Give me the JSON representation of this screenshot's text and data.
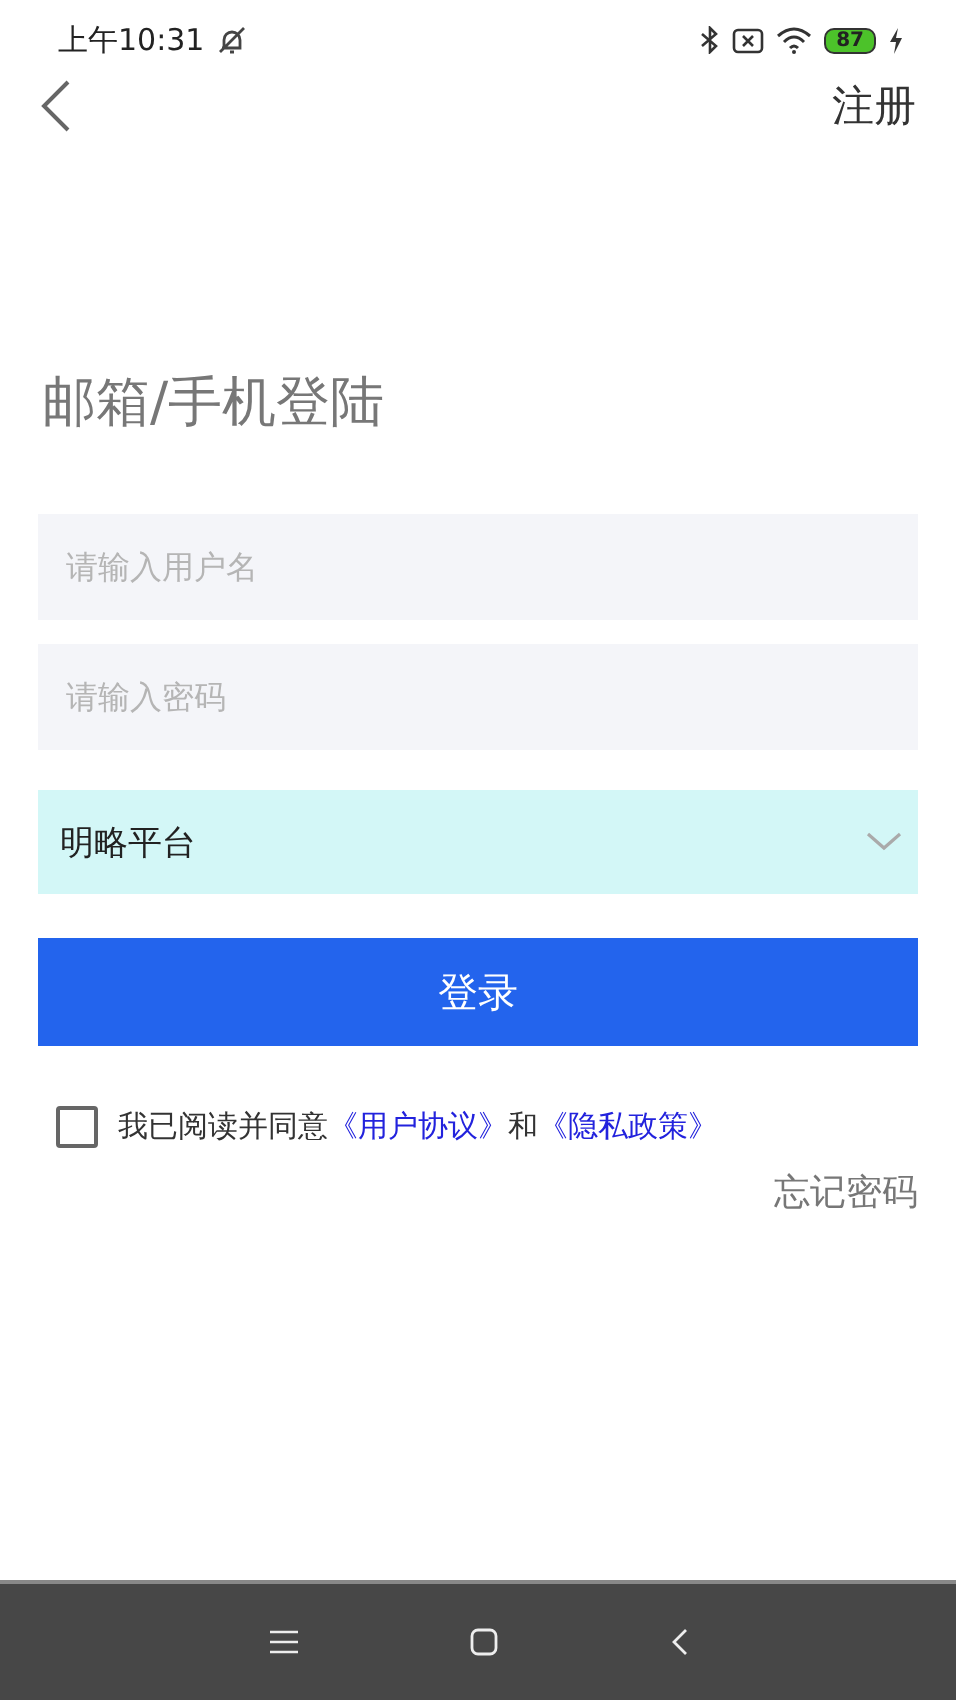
{
  "status_bar": {
    "time": "上午10:31",
    "battery": "87"
  },
  "header": {
    "action": "注册"
  },
  "title": "邮箱/手机登陆",
  "fields": [
    {
      "placeholder": "请输入用户名"
    },
    {
      "placeholder": "请输入密码"
    }
  ],
  "platform_select": {
    "value": "明略平台"
  },
  "login_button": "登录",
  "agreement": {
    "checked": false,
    "parts": [
      {
        "kind": "text",
        "text": "我已阅读并同意"
      },
      {
        "kind": "link",
        "text": "《用户协议》"
      },
      {
        "kind": "text",
        "text": "和"
      },
      {
        "kind": "link",
        "text": "《隐私政策》"
      }
    ]
  },
  "forgot_password": "忘记密码"
}
